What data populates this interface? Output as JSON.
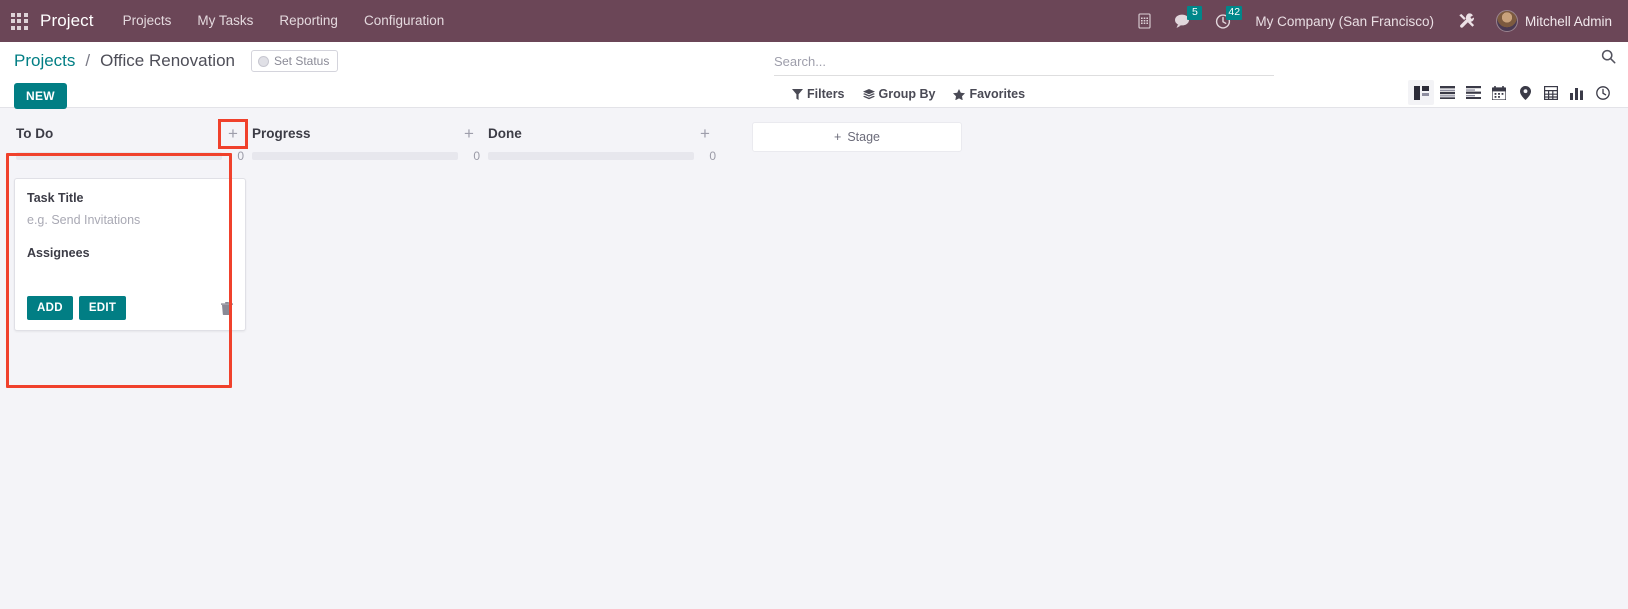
{
  "navbar": {
    "apps_icon": "apps-grid-icon",
    "brand": "Project",
    "menu": [
      {
        "label": "Projects"
      },
      {
        "label": "My Tasks"
      },
      {
        "label": "Reporting"
      },
      {
        "label": "Configuration"
      }
    ],
    "icons": {
      "phone": "phone-icon",
      "messages": "messages-icon",
      "activities": "activities-clock-icon",
      "debug": "wrench-tools-icon"
    },
    "messages_count": "5",
    "activities_count": "42",
    "company": "My Company (San Francisco)",
    "user_name": "Mitchell Admin",
    "colors": {
      "navbar_bg": "#6b4657",
      "badge_bg": "#00878a"
    }
  },
  "control_panel": {
    "breadcrumb_root": "Projects",
    "breadcrumb_sep": "/",
    "breadcrumb_current": "Office Renovation",
    "set_status_label": "Set Status",
    "new_label": "NEW",
    "search_placeholder": "Search...",
    "filters_label": "Filters",
    "group_by_label": "Group By",
    "favorites_label": "Favorites",
    "views": [
      {
        "name": "kanban",
        "active": true
      },
      {
        "name": "list",
        "active": false
      },
      {
        "name": "activity",
        "active": false
      },
      {
        "name": "calendar",
        "active": false
      },
      {
        "name": "map",
        "active": false
      },
      {
        "name": "pivot",
        "active": false
      },
      {
        "name": "graph",
        "active": false
      },
      {
        "name": "clock",
        "active": false
      }
    ],
    "accent_color": "#017e84"
  },
  "kanban": {
    "columns": [
      {
        "title": "To Do",
        "count": "0",
        "plus": "+",
        "plus_highlighted": true
      },
      {
        "title": "Progress",
        "count": "0",
        "plus": "+",
        "plus_highlighted": false
      },
      {
        "title": "Done",
        "count": "0",
        "plus": "+",
        "plus_highlighted": false
      }
    ],
    "add_stage_label": "Stage",
    "add_stage_plus": "+",
    "quick_create": {
      "title_label": "Task Title",
      "title_value": "",
      "title_placeholder": "e.g. Send Invitations",
      "assignees_label": "Assignees",
      "add_label": "ADD",
      "edit_label": "EDIT",
      "delete_icon": "trash-icon"
    },
    "annotation_color": "#f0412c"
  }
}
